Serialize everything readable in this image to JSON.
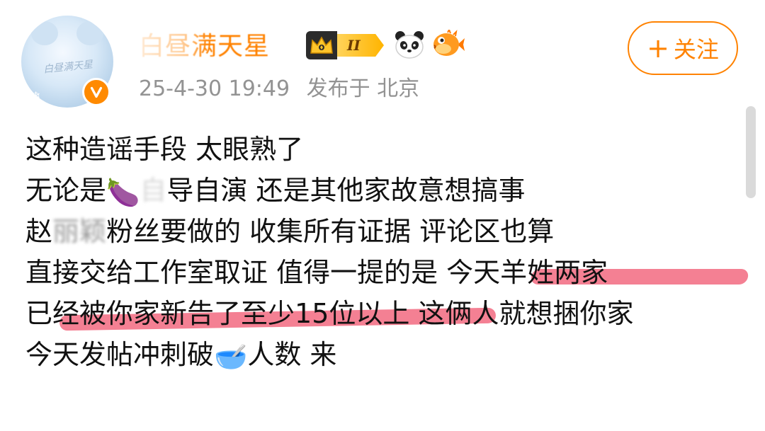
{
  "user": {
    "name": "白昼满天星",
    "avatar_text": "白昼满天星",
    "level": "II",
    "emojis": [
      "panda-icon",
      "pufferfish-icon"
    ],
    "verified_icon": "verified-v-icon"
  },
  "post": {
    "timestamp": "25-4-30 19:49",
    "location": "发布于 北京",
    "lines": [
      [
        "这种造谣手段 太眼熟了"
      ],
      [
        "无论是",
        "🍆",
        "自",
        "导自演 还是其他家故意想搞事"
      ],
      [
        "赵",
        "丽颖",
        "粉丝要做的 收集所有证据 评论区也算"
      ],
      [
        "直接交给工作室取证 值得一提的是 ",
        "今天羊姓两家"
      ],
      [
        "已",
        "经被你家新告了至少15位以上",
        " 这俩人就想捆你家"
      ],
      [
        "今天发帖冲刺破",
        "🥣",
        "人数 来"
      ]
    ]
  },
  "follow_button": {
    "plus": "+",
    "label": "关注"
  },
  "colors": {
    "brand": "#ff8200",
    "meta_text": "#939393",
    "highlight": "#f04f6a"
  }
}
